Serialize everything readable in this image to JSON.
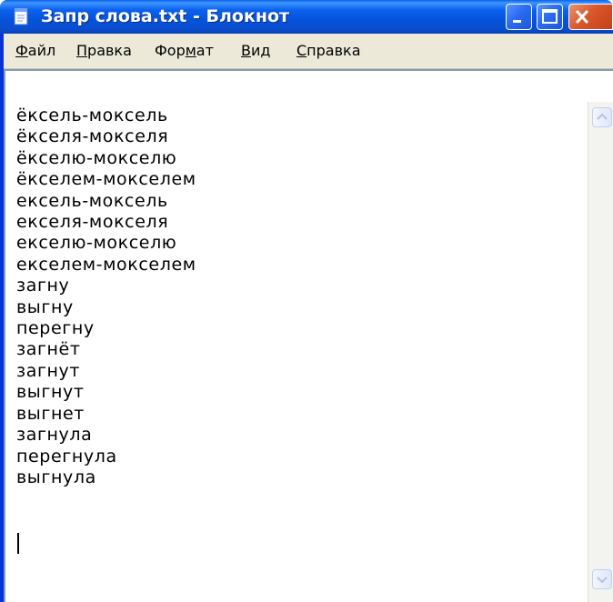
{
  "window": {
    "title": "Запр слова.txt - Блокнот",
    "colors": {
      "titlebar": "#0a5fe8",
      "close_button": "#d9572a",
      "menubar": "#ece9d8"
    }
  },
  "menu": {
    "file": {
      "accel": "Ф",
      "rest": "айл"
    },
    "edit": {
      "accel": "П",
      "rest": "равка"
    },
    "format": {
      "before": "Фор",
      "accel": "м",
      "after": "ат"
    },
    "view": {
      "accel": "В",
      "rest": "ид"
    },
    "help": {
      "accel": "С",
      "rest": "правка"
    }
  },
  "editor": {
    "lines": [
      "ёксель-моксель",
      "ёкселя-мокселя",
      "ёкселю-мокселю",
      "ёкселем-мокселем",
      "ексель-моксель",
      "екселя-мокселя",
      "екселю-мокселю",
      "екселем-мокселем",
      "загну",
      "выгну",
      "перегну",
      "загнёт",
      "загнут",
      "выгнут",
      "выгнет",
      "загнула",
      "перегнула",
      "выгнула"
    ]
  },
  "icons": {
    "app": "notepad-icon",
    "minimize": "minimize-icon",
    "maximize": "maximize-icon",
    "close": "close-icon",
    "scroll_up": "arrow-up-icon",
    "scroll_down": "arrow-down-icon"
  }
}
